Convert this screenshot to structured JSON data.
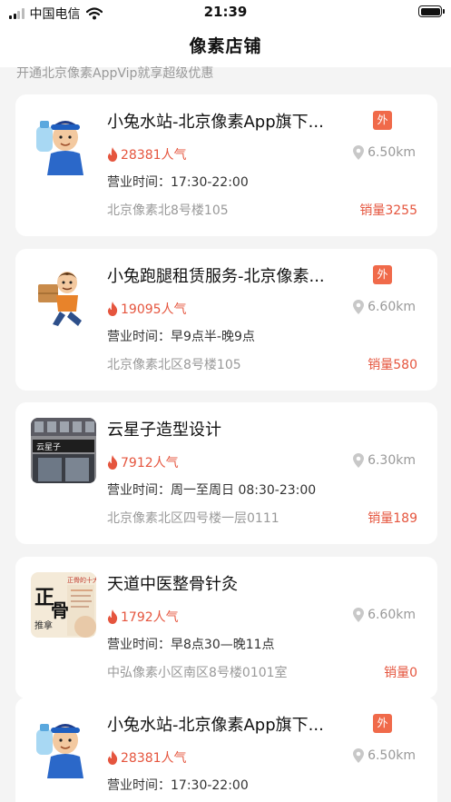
{
  "status_bar": {
    "carrier": "中国电信",
    "time": "21:39"
  },
  "nav": {
    "title": "像素店铺"
  },
  "promo_text": "开通北京像素AppVip就享超级优惠",
  "shops": [
    {
      "name": "小兔水站-北京像素App旗下...",
      "badge": "外",
      "popularity": "28381人气",
      "distance": "6.50km",
      "hours": "营业时间：17:30-22:00",
      "address": "北京像素北8号楼105",
      "sales": "销量3255",
      "thumb": "water-delivery-man-thumbnail"
    },
    {
      "name": "小兔跑腿租赁服务-北京像素...",
      "badge": "外",
      "popularity": "19095人气",
      "distance": "6.60km",
      "hours": "营业时间：早9点半-晚9点",
      "address": "北京像素北区8号楼105",
      "sales": "销量580",
      "thumb": "courier-runner-thumbnail"
    },
    {
      "name": "云星子造型设计",
      "popularity": "7912人气",
      "distance": "6.30km",
      "hours": "营业时间：周一至周日 08:30-23:00",
      "address": "北京像素北区四号楼一层0111",
      "sales": "销量189",
      "thumb": "salon-storefront-thumbnail"
    },
    {
      "name": "天道中医整骨针灸",
      "popularity": "1792人气",
      "distance": "6.60km",
      "hours": "营业时间：早8点30—晚11点",
      "address": "中弘像素小区南区8号楼0101室",
      "sales": "销量0",
      "thumb": "bone-setting-poster-thumbnail"
    },
    {
      "name": "小兔水站-北京像素App旗下...",
      "badge": "外",
      "popularity": "28381人气",
      "distance": "6.50km",
      "hours": "营业时间：17:30-22:00",
      "thumb": "water-delivery-man-thumbnail"
    }
  ],
  "poster_text": {
    "title": "正骨的十大",
    "left": "正",
    "right": "骨",
    "bottom": "推拿",
    "items": "1.调理 2.调气血 3.调经脉 4.调筋骨 5.活血化瘀"
  },
  "salon_sign": "云星子",
  "colors": {
    "accent": "#e5553e",
    "badge": "#f06a4a",
    "muted": "#999999",
    "background": "#f4f4f4"
  }
}
